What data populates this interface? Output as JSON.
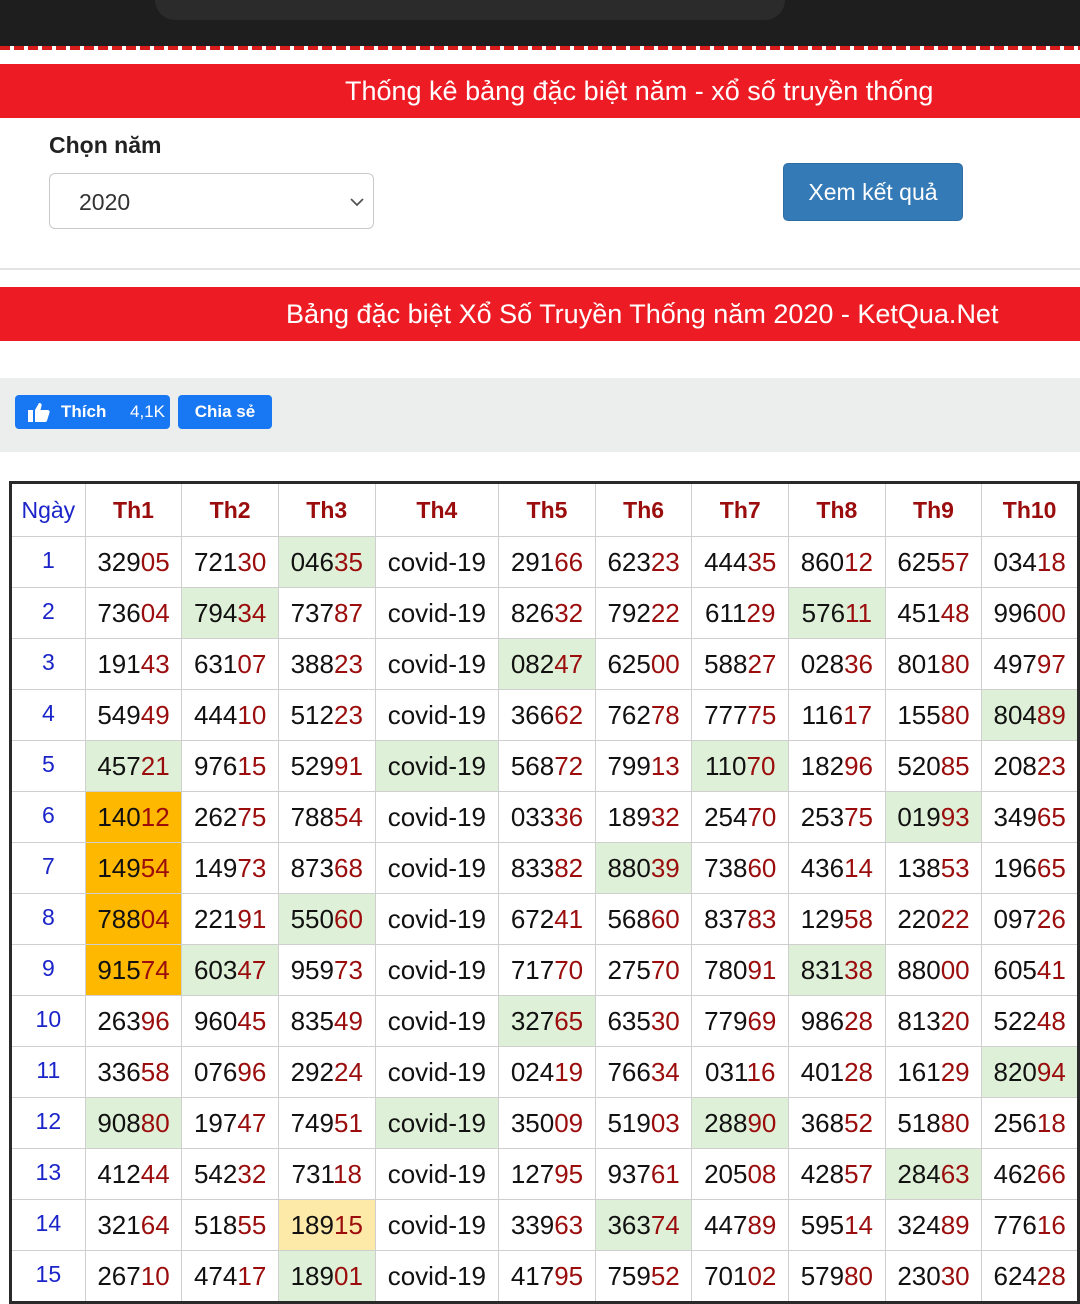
{
  "banner1": "Thống kê bảng đặc biệt năm - xổ số truyền thống",
  "form": {
    "label": "Chọn năm",
    "year_selected": "2020",
    "button": "Xem kết quả"
  },
  "banner2": "Bảng đặc biệt Xổ Số Truyền Thống năm 2020 - KetQua.Net",
  "social": {
    "like_label": "Thích",
    "like_count": "4,1K",
    "share_label": "Chia sẻ"
  },
  "table": {
    "headers": [
      "Ngày",
      "Th1",
      "Th2",
      "Th3",
      "Th4",
      "Th5",
      "Th6",
      "Th7",
      "Th8",
      "Th9",
      "Th10"
    ],
    "highlight_colors": {
      "green": "#dff0d8",
      "orange": "#ffb800",
      "yellow": "#fde9a8",
      "tail_digit_color": "#9b0d0d"
    },
    "rows": [
      {
        "day": "1",
        "cells": [
          "32905",
          "72130",
          "04635",
          "covid-19",
          "29166",
          "62323",
          "44435",
          "86012",
          "62557",
          "03418"
        ],
        "hl": {
          "2": "g"
        }
      },
      {
        "day": "2",
        "cells": [
          "73604",
          "79434",
          "73787",
          "covid-19",
          "82632",
          "79222",
          "61129",
          "57611",
          "45148",
          "99600"
        ],
        "hl": {
          "1": "g",
          "7": "g"
        }
      },
      {
        "day": "3",
        "cells": [
          "19143",
          "63107",
          "38823",
          "covid-19",
          "08247",
          "62500",
          "58827",
          "02836",
          "80180",
          "49797"
        ],
        "hl": {
          "4": "g"
        }
      },
      {
        "day": "4",
        "cells": [
          "54949",
          "44410",
          "51223",
          "covid-19",
          "36662",
          "76278",
          "77775",
          "11617",
          "15580",
          "80489"
        ],
        "hl": {
          "9": "g"
        }
      },
      {
        "day": "5",
        "cells": [
          "45721",
          "97615",
          "52991",
          "covid-19",
          "56872",
          "79913",
          "11070",
          "18296",
          "52085",
          "20823"
        ],
        "hl": {
          "0": "g",
          "3": "g",
          "6": "g"
        }
      },
      {
        "day": "6",
        "cells": [
          "14012",
          "26275",
          "78854",
          "covid-19",
          "03336",
          "18932",
          "25470",
          "25375",
          "01993",
          "34965"
        ],
        "hl": {
          "0": "o",
          "8": "g"
        }
      },
      {
        "day": "7",
        "cells": [
          "14954",
          "14973",
          "87368",
          "covid-19",
          "83382",
          "88039",
          "73860",
          "43614",
          "13853",
          "19665"
        ],
        "hl": {
          "0": "o",
          "5": "g"
        }
      },
      {
        "day": "8",
        "cells": [
          "78804",
          "22191",
          "55060",
          "covid-19",
          "67241",
          "56860",
          "83783",
          "12958",
          "22022",
          "09726"
        ],
        "hl": {
          "0": "o",
          "2": "g"
        }
      },
      {
        "day": "9",
        "cells": [
          "91574",
          "60347",
          "95973",
          "covid-19",
          "71770",
          "27570",
          "78091",
          "83138",
          "88000",
          "60541"
        ],
        "hl": {
          "0": "o",
          "1": "g",
          "7": "g"
        }
      },
      {
        "day": "10",
        "cells": [
          "26396",
          "96045",
          "83549",
          "covid-19",
          "32765",
          "63530",
          "77969",
          "98628",
          "81320",
          "52248"
        ],
        "hl": {
          "4": "g"
        }
      },
      {
        "day": "11",
        "cells": [
          "33658",
          "07696",
          "29224",
          "covid-19",
          "02419",
          "76634",
          "03116",
          "40128",
          "16129",
          "82094"
        ],
        "hl": {
          "9": "g"
        }
      },
      {
        "day": "12",
        "cells": [
          "90880",
          "19747",
          "74951",
          "covid-19",
          "35009",
          "51903",
          "28890",
          "36852",
          "51880",
          "25618"
        ],
        "hl": {
          "0": "g",
          "3": "g",
          "6": "g"
        }
      },
      {
        "day": "13",
        "cells": [
          "41244",
          "54232",
          "73118",
          "covid-19",
          "12795",
          "93761",
          "20508",
          "42857",
          "28463",
          "46266"
        ],
        "hl": {
          "8": "g"
        }
      },
      {
        "day": "14",
        "cells": [
          "32164",
          "51855",
          "18915",
          "covid-19",
          "33963",
          "36374",
          "44789",
          "59514",
          "32489",
          "77616"
        ],
        "hl": {
          "2": "y",
          "5": "g"
        }
      },
      {
        "day": "15",
        "cells": [
          "26710",
          "47417",
          "18901",
          "covid-19",
          "41795",
          "75952",
          "70102",
          "57980",
          "23030",
          "62428"
        ],
        "hl": {
          "2": "g"
        }
      }
    ]
  }
}
